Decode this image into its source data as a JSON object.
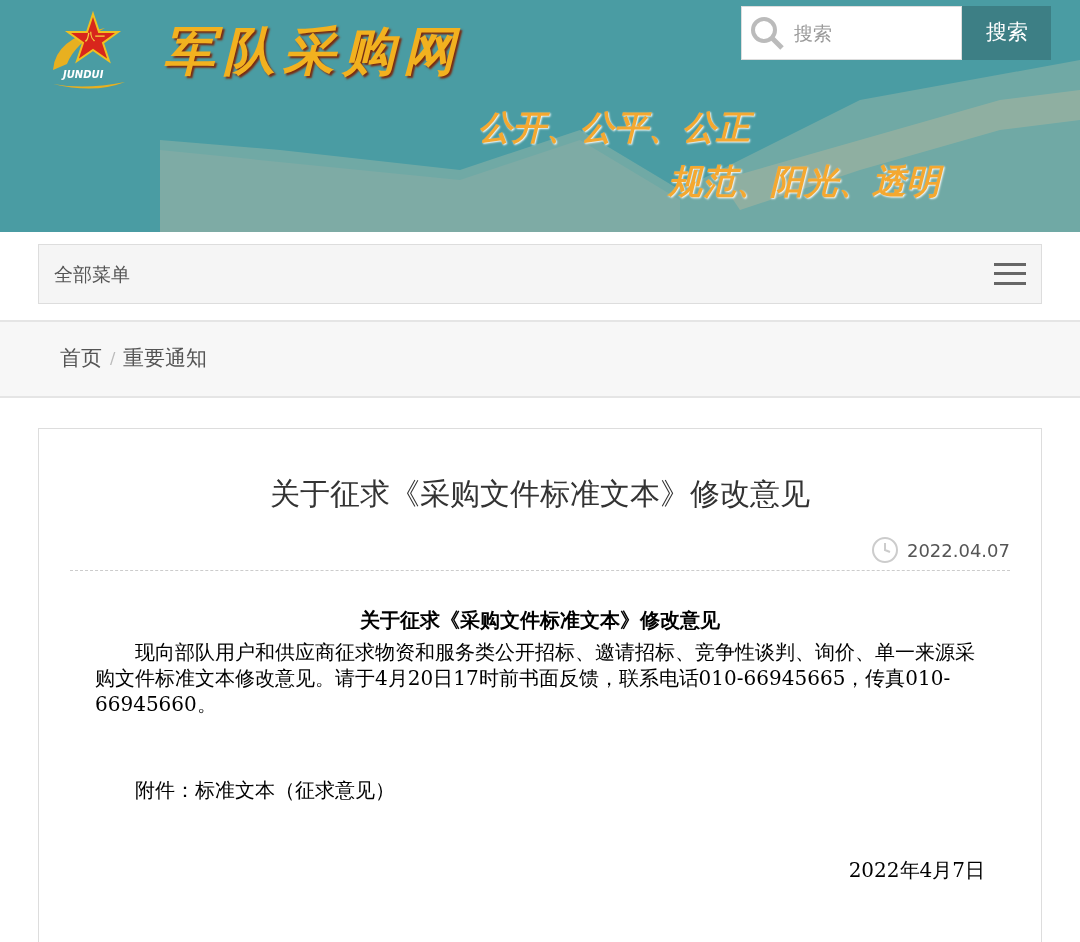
{
  "header": {
    "emblem_text": "八一",
    "emblem_label": "JUNDUI",
    "site_name": "军队采购网",
    "slogans": [
      "公开、公平、公正",
      "规范、阳光、透明"
    ],
    "search": {
      "placeholder": "搜索",
      "button": "搜索"
    }
  },
  "nav": {
    "menu_label": "全部菜单"
  },
  "breadcrumb": {
    "separator": "/",
    "items": [
      {
        "label": "首页"
      },
      {
        "label": "重要通知"
      }
    ]
  },
  "article": {
    "title": "关于征求《采购文件标准文本》修改意见",
    "date": "2022.04.07",
    "body_title": "关于征求《采购文件标准文本》修改意见",
    "paragraph": "现向部队用户和供应商征求物资和服务类公开招标、邀请招标、竞争性谈判、询价、单一来源采购文件标准文本修改意见。请于4月20日17时前书面反馈，联系电话010-66945665，传真010-66945660。",
    "attachment": "附件：标准文本（征求意见）",
    "signature_date": "2022年4月7日"
  }
}
